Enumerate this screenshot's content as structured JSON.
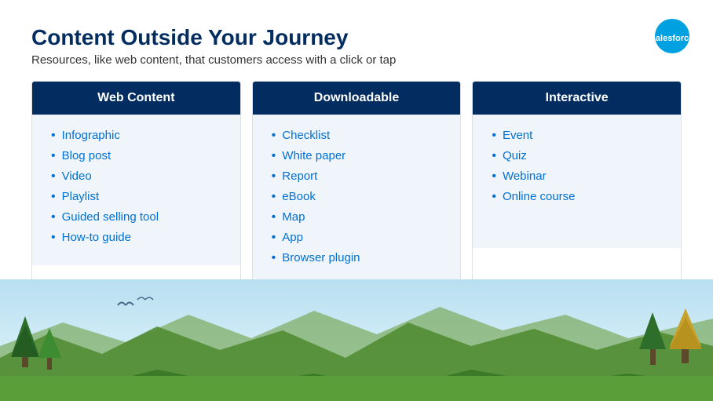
{
  "slide": {
    "title": "Content Outside Your Journey",
    "subtitle": "Resources, like web content, that customers access with a click or tap"
  },
  "columns": [
    {
      "id": "web-content",
      "header": "Web Content",
      "items": [
        "Infographic",
        "Blog post",
        "Video",
        "Playlist",
        "Guided selling tool",
        "How-to guide"
      ]
    },
    {
      "id": "downloadable",
      "header": "Downloadable",
      "items": [
        "Checklist",
        "White paper",
        "Report",
        "eBook",
        "Map",
        "App",
        "Browser plugin"
      ]
    },
    {
      "id": "interactive",
      "header": "Interactive",
      "items": [
        "Event",
        "Quiz",
        "Webinar",
        "Online course"
      ]
    }
  ],
  "logo": {
    "alt": "Salesforce"
  }
}
